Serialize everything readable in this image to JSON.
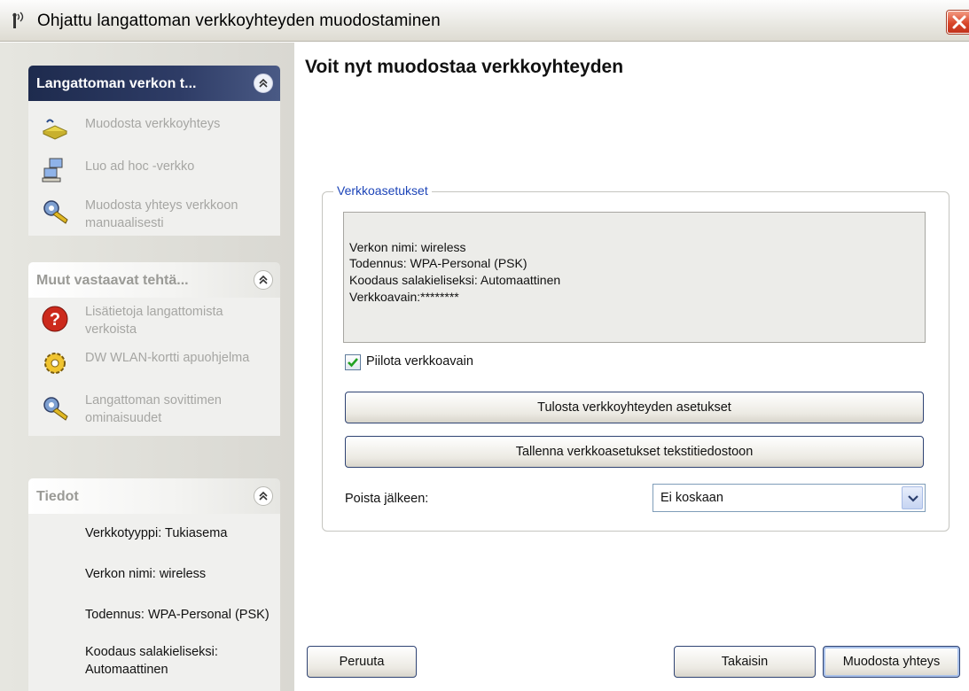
{
  "window": {
    "title": "Ohjattu langattoman verkkoyhteyden muodostaminen"
  },
  "sidebar": {
    "groups": [
      {
        "title": "Langattoman verkon t...",
        "tasks": [
          {
            "label": "Muodosta verkkoyhteys",
            "icon": "network-setup-icon"
          },
          {
            "label": "Luo ad hoc -verkko",
            "icon": "computers-icon"
          },
          {
            "label": "Muodosta yhteys verkkoon manuaalisesti",
            "icon": "gears-wrench-icon"
          }
        ]
      },
      {
        "title": "Muut vastaavat tehtä...",
        "tasks": [
          {
            "label": "Lisätietoja langattomista verkoista",
            "icon": "help-icon"
          },
          {
            "label": "DW WLAN-kortti apuohjelma",
            "icon": "gear-icon"
          },
          {
            "label": "Langattoman sovittimen ominaisuudet",
            "icon": "gears-wrench-icon"
          }
        ]
      },
      {
        "title": "Tiedot",
        "lines": [
          "Verkkotyyppi: Tukiasema",
          "Verkon nimi: wireless",
          "Todennus: WPA-Personal (PSK)",
          "Koodaus salakieliseksi: Automaattinen"
        ]
      }
    ]
  },
  "main": {
    "heading": "Voit nyt muodostaa verkkoyhteyden",
    "settings": {
      "legend": "Verkkoasetukset",
      "lines": [
        "Verkon nimi: wireless",
        "Todennus: WPA-Personal (PSK)",
        "Koodaus salakieliseksi: Automaattinen",
        "Verkkoavain:********"
      ],
      "hide_key_label": "Piilota verkkoavain",
      "hide_key_checked": true,
      "print_button": "Tulosta verkkoyhteyden asetukset",
      "save_button": "Tallenna verkkoasetukset tekstitiedostoon",
      "delete_after_label": "Poista jälkeen:",
      "delete_after_value": "Ei koskaan"
    }
  },
  "footer": {
    "cancel": "Peruuta",
    "back": "Takaisin",
    "connect": "Muodosta yhteys"
  },
  "colors": {
    "header_dark": "#1e2b4e",
    "legend_blue": "#1c44b8",
    "close_red": "#d9472b"
  }
}
